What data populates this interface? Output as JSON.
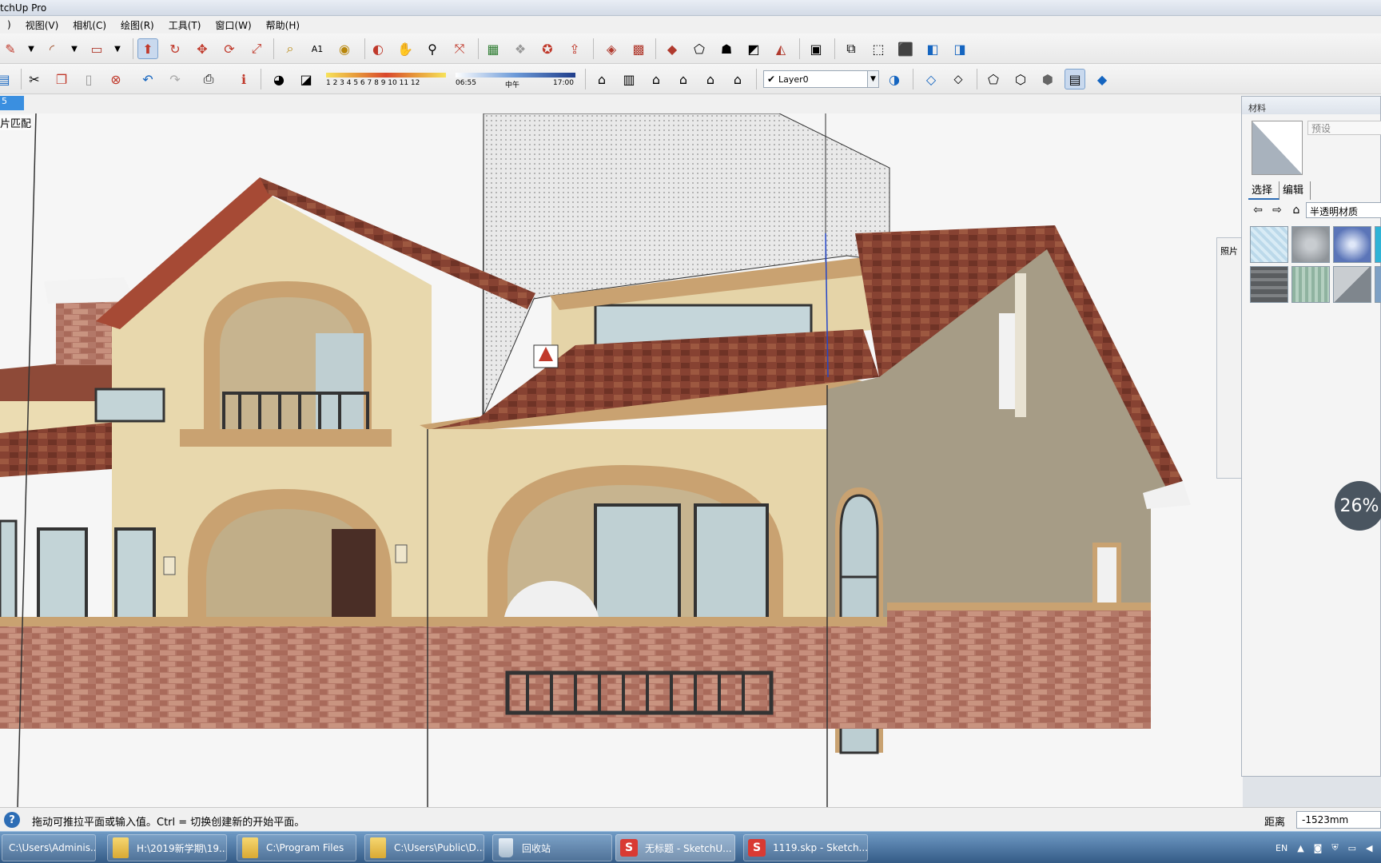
{
  "app": {
    "title": "SketchUp Pro",
    "title_visible": "tchUp Pro"
  },
  "menubar": {
    "items": [
      {
        "label": ")"
      },
      {
        "label": "视图(V)"
      },
      {
        "label": "相机(C)"
      },
      {
        "label": "绘图(R)"
      },
      {
        "label": "工具(T)"
      },
      {
        "label": "窗口(W)"
      },
      {
        "label": "帮助(H)"
      }
    ]
  },
  "toolbar": {
    "shadow_months": "1  2  3  4  5  6  7  8  9  10 11 12",
    "time_start": "06:55",
    "time_mid": "中午",
    "time_end": "17:00",
    "layer": "Layer0"
  },
  "scene": {
    "tab_label": "5"
  },
  "viewport": {
    "photo_match_label": "片匹配",
    "zoom_percent": "26%"
  },
  "photo_panel": {
    "title": "照片"
  },
  "materials": {
    "title": "材料",
    "name_placeholder": "预设",
    "tabs": [
      {
        "label": "选择"
      },
      {
        "label": "编辑"
      }
    ],
    "collection": "半透明材质",
    "swatch_colors": [
      "#bcd9ea",
      "#aeb3b8",
      "#6b85c2",
      "#2fb3d6",
      "#6a6d70",
      "#8fb3a0",
      "#9da3a8",
      "#7ea1c5"
    ]
  },
  "status": {
    "text": "拖动可推拉平面或输入值。Ctrl = 切换创建新的开始平面。",
    "measure_label": "距离",
    "measure_value": "-1523mm"
  },
  "taskbar": {
    "items": [
      {
        "label": "C:\\Users\\Adminis...",
        "icon": "folder-icon"
      },
      {
        "label": "H:\\2019新学期\\19...",
        "icon": "folder-icon"
      },
      {
        "label": "C:\\Program Files",
        "icon": "folder-icon"
      },
      {
        "label": "C:\\Users\\Public\\D...",
        "icon": "folder-icon"
      },
      {
        "label": "回收站",
        "icon": "recycle-bin-icon"
      },
      {
        "label": "无标题 - SketchU...",
        "icon": "sketchup-icon"
      },
      {
        "label": "1119.skp - Sketch...",
        "icon": "sketchup-icon"
      }
    ],
    "tray_lang": "EN"
  }
}
